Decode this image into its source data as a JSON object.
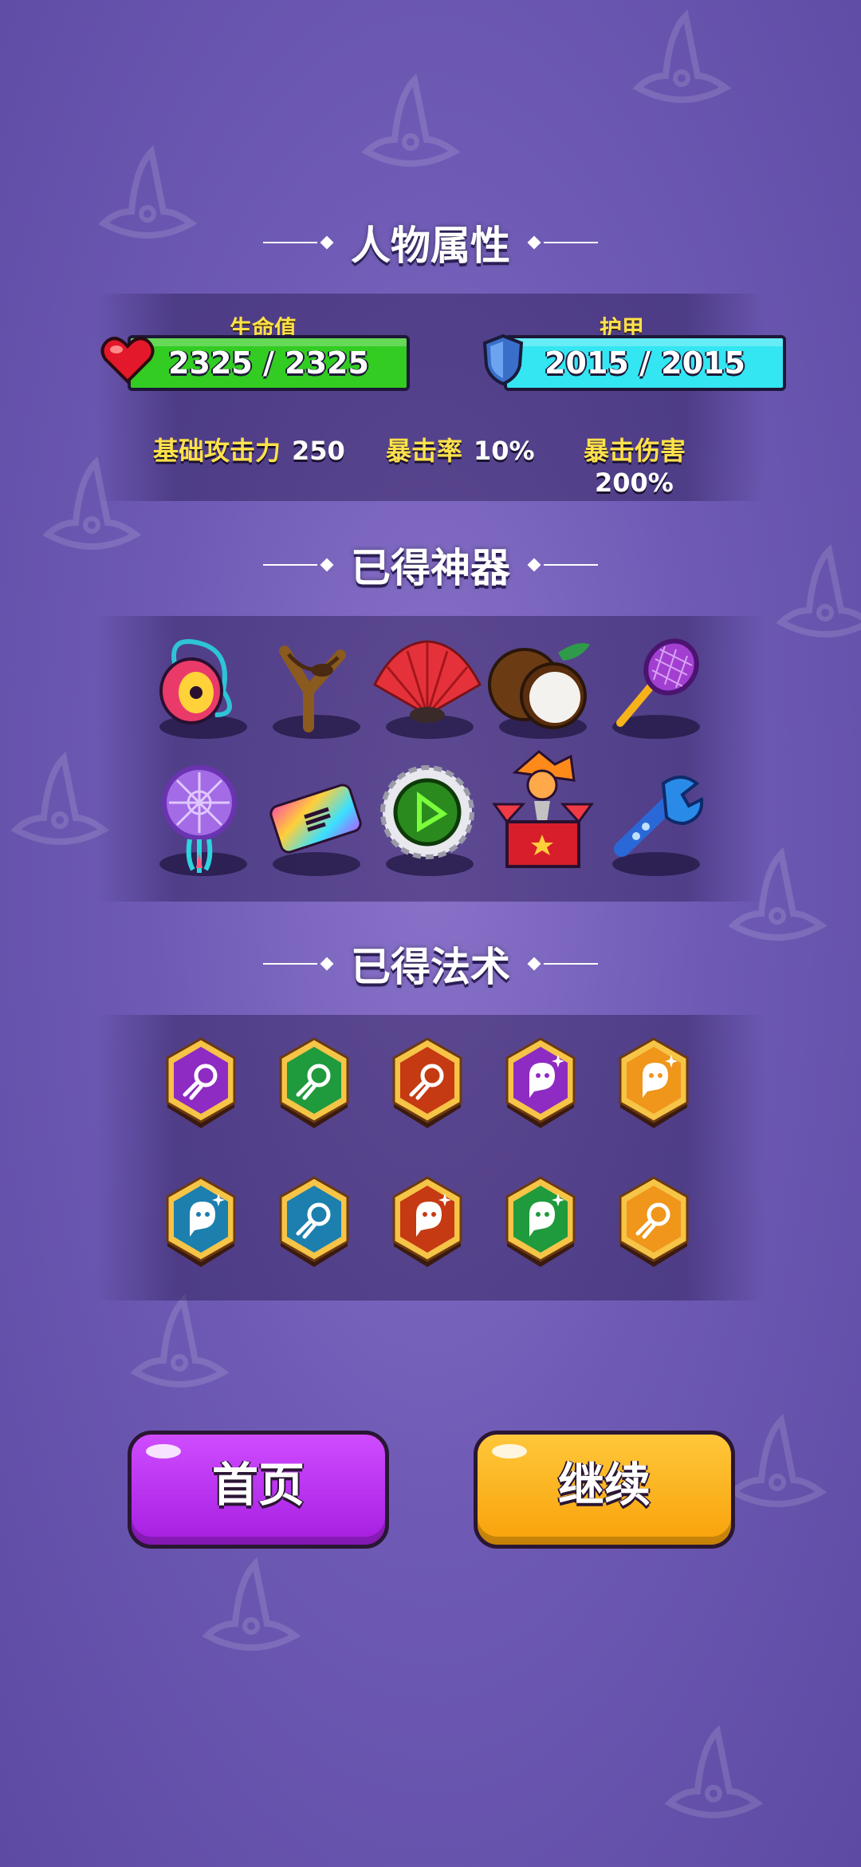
{
  "attributes": {
    "title": "人物属性",
    "hp": {
      "label": "生命值",
      "value": "2325 / 2325",
      "current": 2325,
      "max": 2325,
      "color": "#33cc22"
    },
    "armor": {
      "label": "护甲",
      "value": "2015 / 2015",
      "current": 2015,
      "max": 2015,
      "color": "#33e6f2"
    },
    "stats": [
      {
        "label": "基础攻击力",
        "value": "250"
      },
      {
        "label": "暴击率",
        "value": "10%"
      },
      {
        "label": "暴击伤害",
        "value": "200%"
      }
    ]
  },
  "artifacts": {
    "title": "已得神器",
    "items": [
      {
        "icon": "yoyo-icon"
      },
      {
        "icon": "slingshot-icon"
      },
      {
        "icon": "fan-icon"
      },
      {
        "icon": "coconut-icon"
      },
      {
        "icon": "racket-icon"
      },
      {
        "icon": "dreamcatcher-icon"
      },
      {
        "icon": "rainbow-ticket-icon"
      },
      {
        "icon": "bottlecap-icon"
      },
      {
        "icon": "jack-in-box-icon"
      },
      {
        "icon": "wrench-icon"
      }
    ]
  },
  "spells": {
    "title": "已得法术",
    "items": [
      {
        "icon": "comet-spell-icon",
        "color": "#8e2bc2"
      },
      {
        "icon": "comet-spell-icon",
        "color": "#1f9a3c"
      },
      {
        "icon": "comet-spell-icon",
        "color": "#c53a12"
      },
      {
        "icon": "ghost-spell-icon",
        "color": "#8e2bc2"
      },
      {
        "icon": "ghost-spell-icon",
        "color": "#f0961a"
      },
      {
        "icon": "ghost-spell-icon",
        "color": "#1c7fae"
      },
      {
        "icon": "comet-spell-icon",
        "color": "#1c7fae"
      },
      {
        "icon": "ghost-spell-icon",
        "color": "#c53a12"
      },
      {
        "icon": "ghost-spell-icon",
        "color": "#1f9a3c"
      },
      {
        "icon": "comet-spell-icon",
        "color": "#f0961a"
      }
    ]
  },
  "buttons": {
    "home": "首页",
    "continue": "继续"
  },
  "colors": {
    "home_button": "#b629f0",
    "continue_button": "#ffb20f",
    "stat_label": "#ffe14a"
  }
}
